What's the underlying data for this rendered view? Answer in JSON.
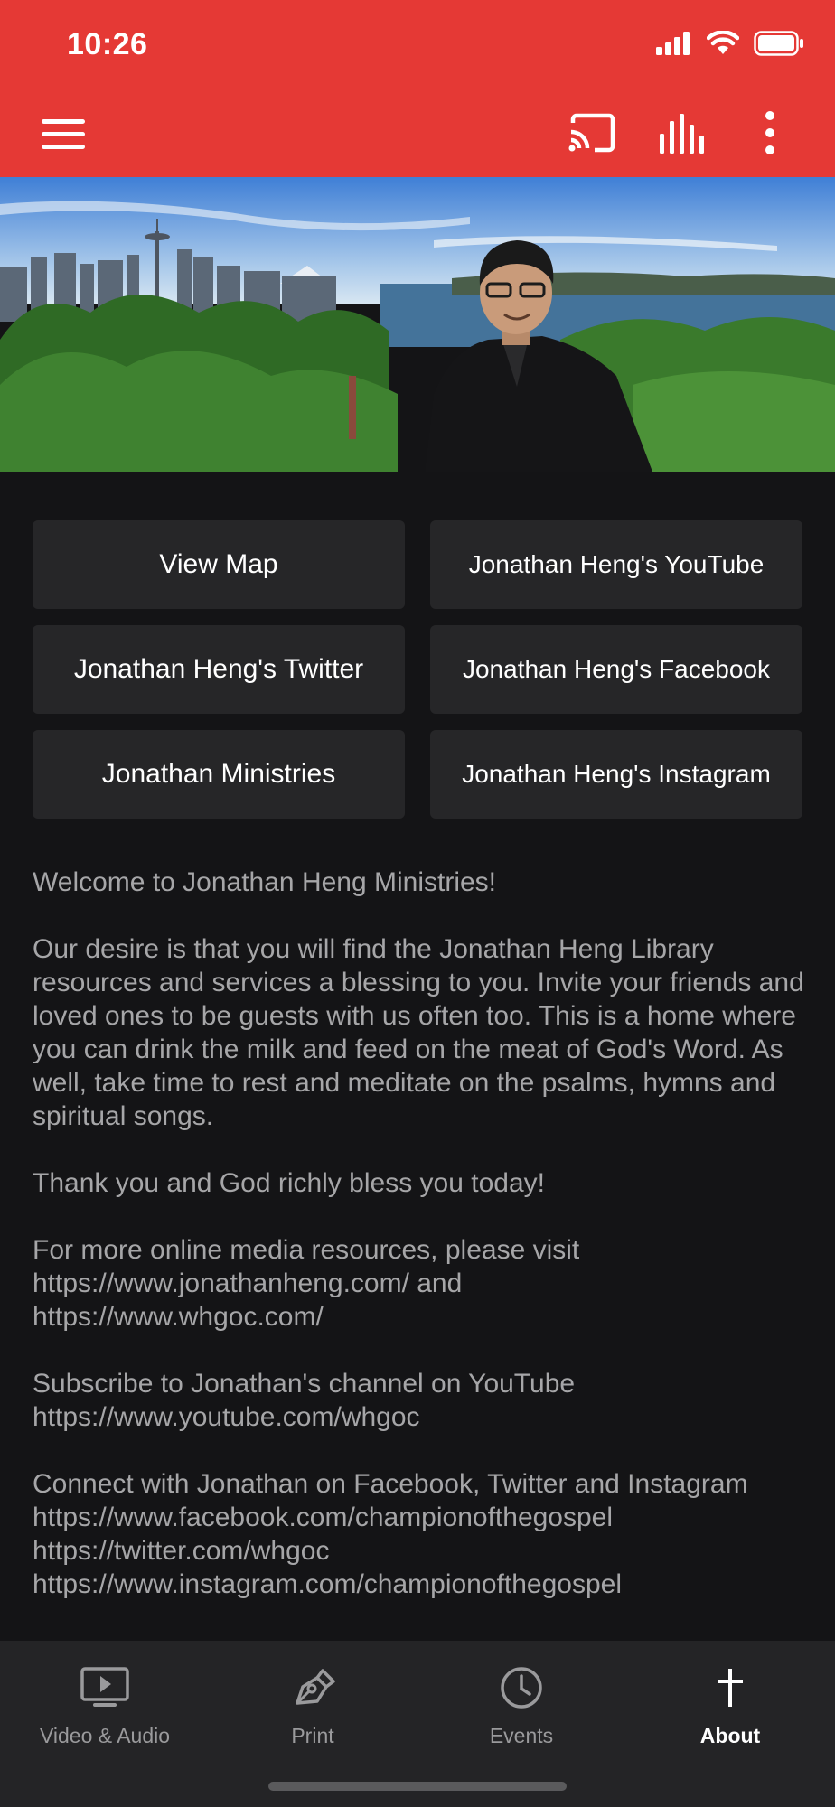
{
  "status_bar": {
    "time": "10:26"
  },
  "toolbar": {
    "menu_icon": "hamburger-menu-icon",
    "cast_icon": "cast-icon",
    "equalizer_icon": "equalizer-icon",
    "more_icon": "more-vertical-icon"
  },
  "hero": {
    "alt": "Jonathan Heng with Seattle skyline"
  },
  "links": [
    {
      "label": "View Map"
    },
    {
      "label": "Jonathan Heng's YouTube"
    },
    {
      "label": "Jonathan Heng's Twitter"
    },
    {
      "label": "Jonathan Heng's Facebook"
    },
    {
      "label": "Jonathan Ministries"
    },
    {
      "label": "Jonathan Heng's Instagram"
    }
  ],
  "about": {
    "p1": "Welcome to Jonathan Heng Ministries!",
    "p2": "Our desire is that you will find the Jonathan Heng Library resources and services a blessing to you. Invite your friends and loved ones to be guests with us often too. This is a home where you can drink the milk and feed on the meat of God's Word. As well, take time to rest and meditate on the psalms, hymns and spiritual songs.",
    "p3": "Thank you and God richly bless you today!",
    "p4": "For more online media resources, please visit\nhttps://www.jonathanheng.com/ and\nhttps://www.whgoc.com/",
    "p5": "Subscribe to Jonathan's channel on YouTube\nhttps://www.youtube.com/whgoc",
    "p6": "Connect with Jonathan on Facebook, Twitter and Instagram\nhttps://www.facebook.com/championofthegospel\nhttps://twitter.com/whgoc\nhttps://www.instagram.com/championofthegospel"
  },
  "tabs": [
    {
      "label": "Video & Audio",
      "icon": "video-audio-icon"
    },
    {
      "label": "Print",
      "icon": "pen-icon"
    },
    {
      "label": "Events",
      "icon": "clock-icon"
    },
    {
      "label": "About",
      "icon": "cross-icon",
      "active": true
    }
  ],
  "colors": {
    "accent": "#e53935",
    "background": "#141416",
    "button": "#262628",
    "tabbar": "#242426"
  }
}
